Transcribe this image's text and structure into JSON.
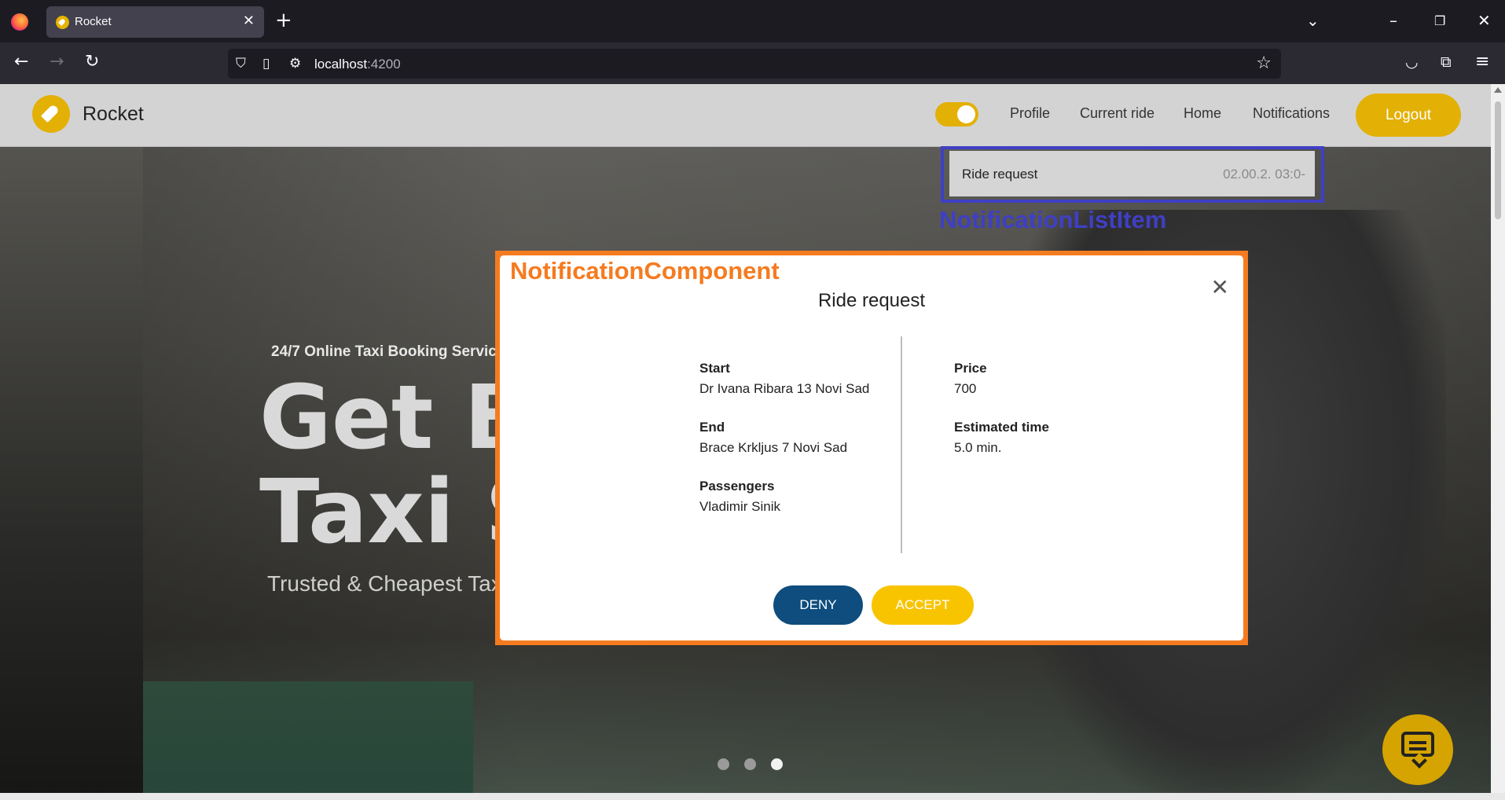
{
  "browser": {
    "tab_title": "Rocket",
    "tab_close": "✕",
    "new_tab": "+",
    "url_host": "localhost",
    "url_port": ":4200",
    "icons": [
      "firefox-icon",
      "back-icon",
      "forward-icon",
      "reload-icon",
      "shield-icon",
      "page-icon",
      "permissions-icon",
      "star-icon",
      "pocket-icon",
      "extensions-icon",
      "menu-icon",
      "list-tabs-icon",
      "minimize-icon",
      "restore-icon",
      "close-window-icon"
    ]
  },
  "header": {
    "brand": "Rocket",
    "toggle_on": true,
    "nav": {
      "profile": "Profile",
      "current_ride": "Current ride",
      "home": "Home",
      "notifications": "Notifications"
    },
    "logout": "Logout"
  },
  "hero": {
    "subtitle": "24/7 Online Taxi Booking Servic",
    "title_line1": "Get B",
    "title_line2": "Taxi S",
    "tagline": "Trusted & Cheapest Tax",
    "slides": 3,
    "active_slide": 3
  },
  "notification_list_item": {
    "annotation": "NotificationListItem",
    "title": "Ride request",
    "time": "02.00.2. 03:0-"
  },
  "notification_modal": {
    "annotation": "NotificationComponent",
    "title": "Ride request",
    "close": "✕",
    "start_label": "Start",
    "start_value": "Dr Ivana Ribara 13 Novi Sad",
    "end_label": "End",
    "end_value": "Brace Krkljus 7 Novi Sad",
    "passengers_label": "Passengers",
    "passengers_value": "Vladimir Sinik",
    "price_label": "Price",
    "price_value": "700",
    "estimated_label": "Estimated time",
    "estimated_value": "5.0 min.",
    "deny": "DENY",
    "accept": "ACCEPT"
  },
  "colors": {
    "accent": "#e3b005",
    "deny": "#0e4d7e",
    "accept": "#f8c400",
    "list_item_outline": "#3f3fc4",
    "component_outline": "#f57b20"
  }
}
